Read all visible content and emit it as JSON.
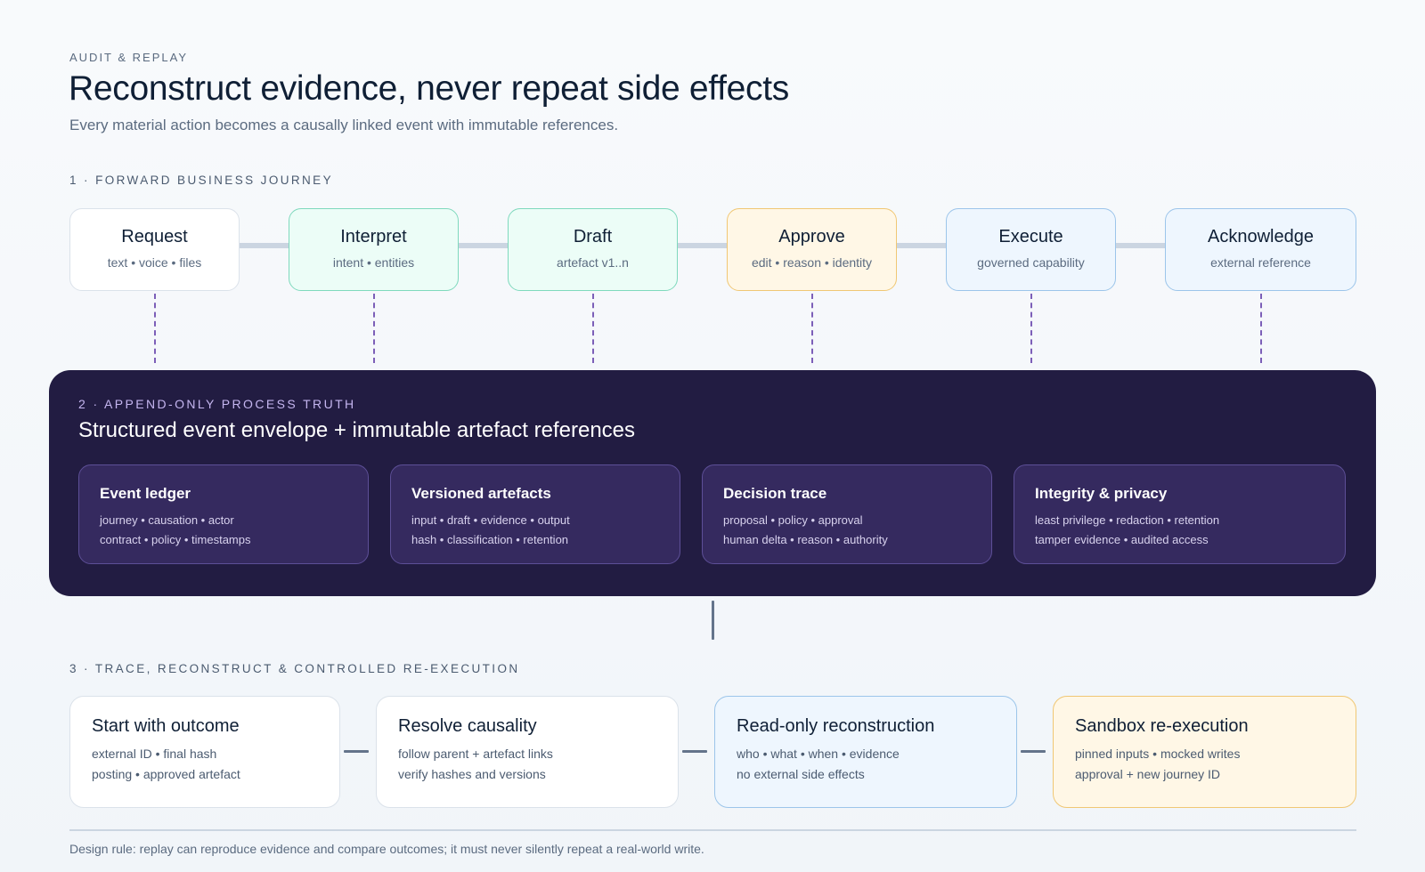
{
  "header": {
    "eyebrow": "AUDIT & REPLAY",
    "title": "Reconstruct evidence, never repeat side effects",
    "subtitle": "Every material action becomes a causally linked event with immutable references."
  },
  "forward": {
    "label": "1 · FORWARD BUSINESS JOURNEY",
    "stages": [
      {
        "title": "Request",
        "sub": "text • voice • files"
      },
      {
        "title": "Interpret",
        "sub": "intent • entities"
      },
      {
        "title": "Draft",
        "sub": "artefact v1..n"
      },
      {
        "title": "Approve",
        "sub": "edit • reason • identity"
      },
      {
        "title": "Execute",
        "sub": "governed capability"
      },
      {
        "title": "Acknowledge",
        "sub": "external reference"
      }
    ]
  },
  "truth": {
    "label": "2 · APPEND-ONLY PROCESS TRUTH",
    "title": "Structured event envelope + immutable artefact references",
    "cards": [
      {
        "title": "Event ledger",
        "lines": [
          "journey • causation • actor",
          "contract • policy • timestamps"
        ]
      },
      {
        "title": "Versioned artefacts",
        "lines": [
          "input • draft • evidence • output",
          "hash • classification • retention"
        ]
      },
      {
        "title": "Decision trace",
        "lines": [
          "proposal • policy • approval",
          "human delta • reason • authority"
        ]
      },
      {
        "title": "Integrity & privacy",
        "lines": [
          "least privilege • redaction • retention",
          "tamper evidence • audited access"
        ]
      }
    ]
  },
  "replay": {
    "label": "3 · TRACE, RECONSTRUCT & CONTROLLED RE-EXECUTION",
    "steps": [
      {
        "title": "Start with outcome",
        "lines": [
          "external ID • final hash",
          "posting • approved artefact"
        ]
      },
      {
        "title": "Resolve causality",
        "lines": [
          "follow parent + artefact links",
          "verify hashes and versions"
        ]
      },
      {
        "title": "Read-only reconstruction",
        "lines": [
          "who • what • when • evidence",
          "no external side effects"
        ]
      },
      {
        "title": "Sandbox re-execution",
        "lines": [
          "pinned inputs • mocked writes",
          "approval + new journey ID"
        ]
      }
    ]
  },
  "footer": {
    "design_rule": "Design rule: replay can reproduce evidence and compare outcomes; it must never silently repeat a real-world write."
  }
}
